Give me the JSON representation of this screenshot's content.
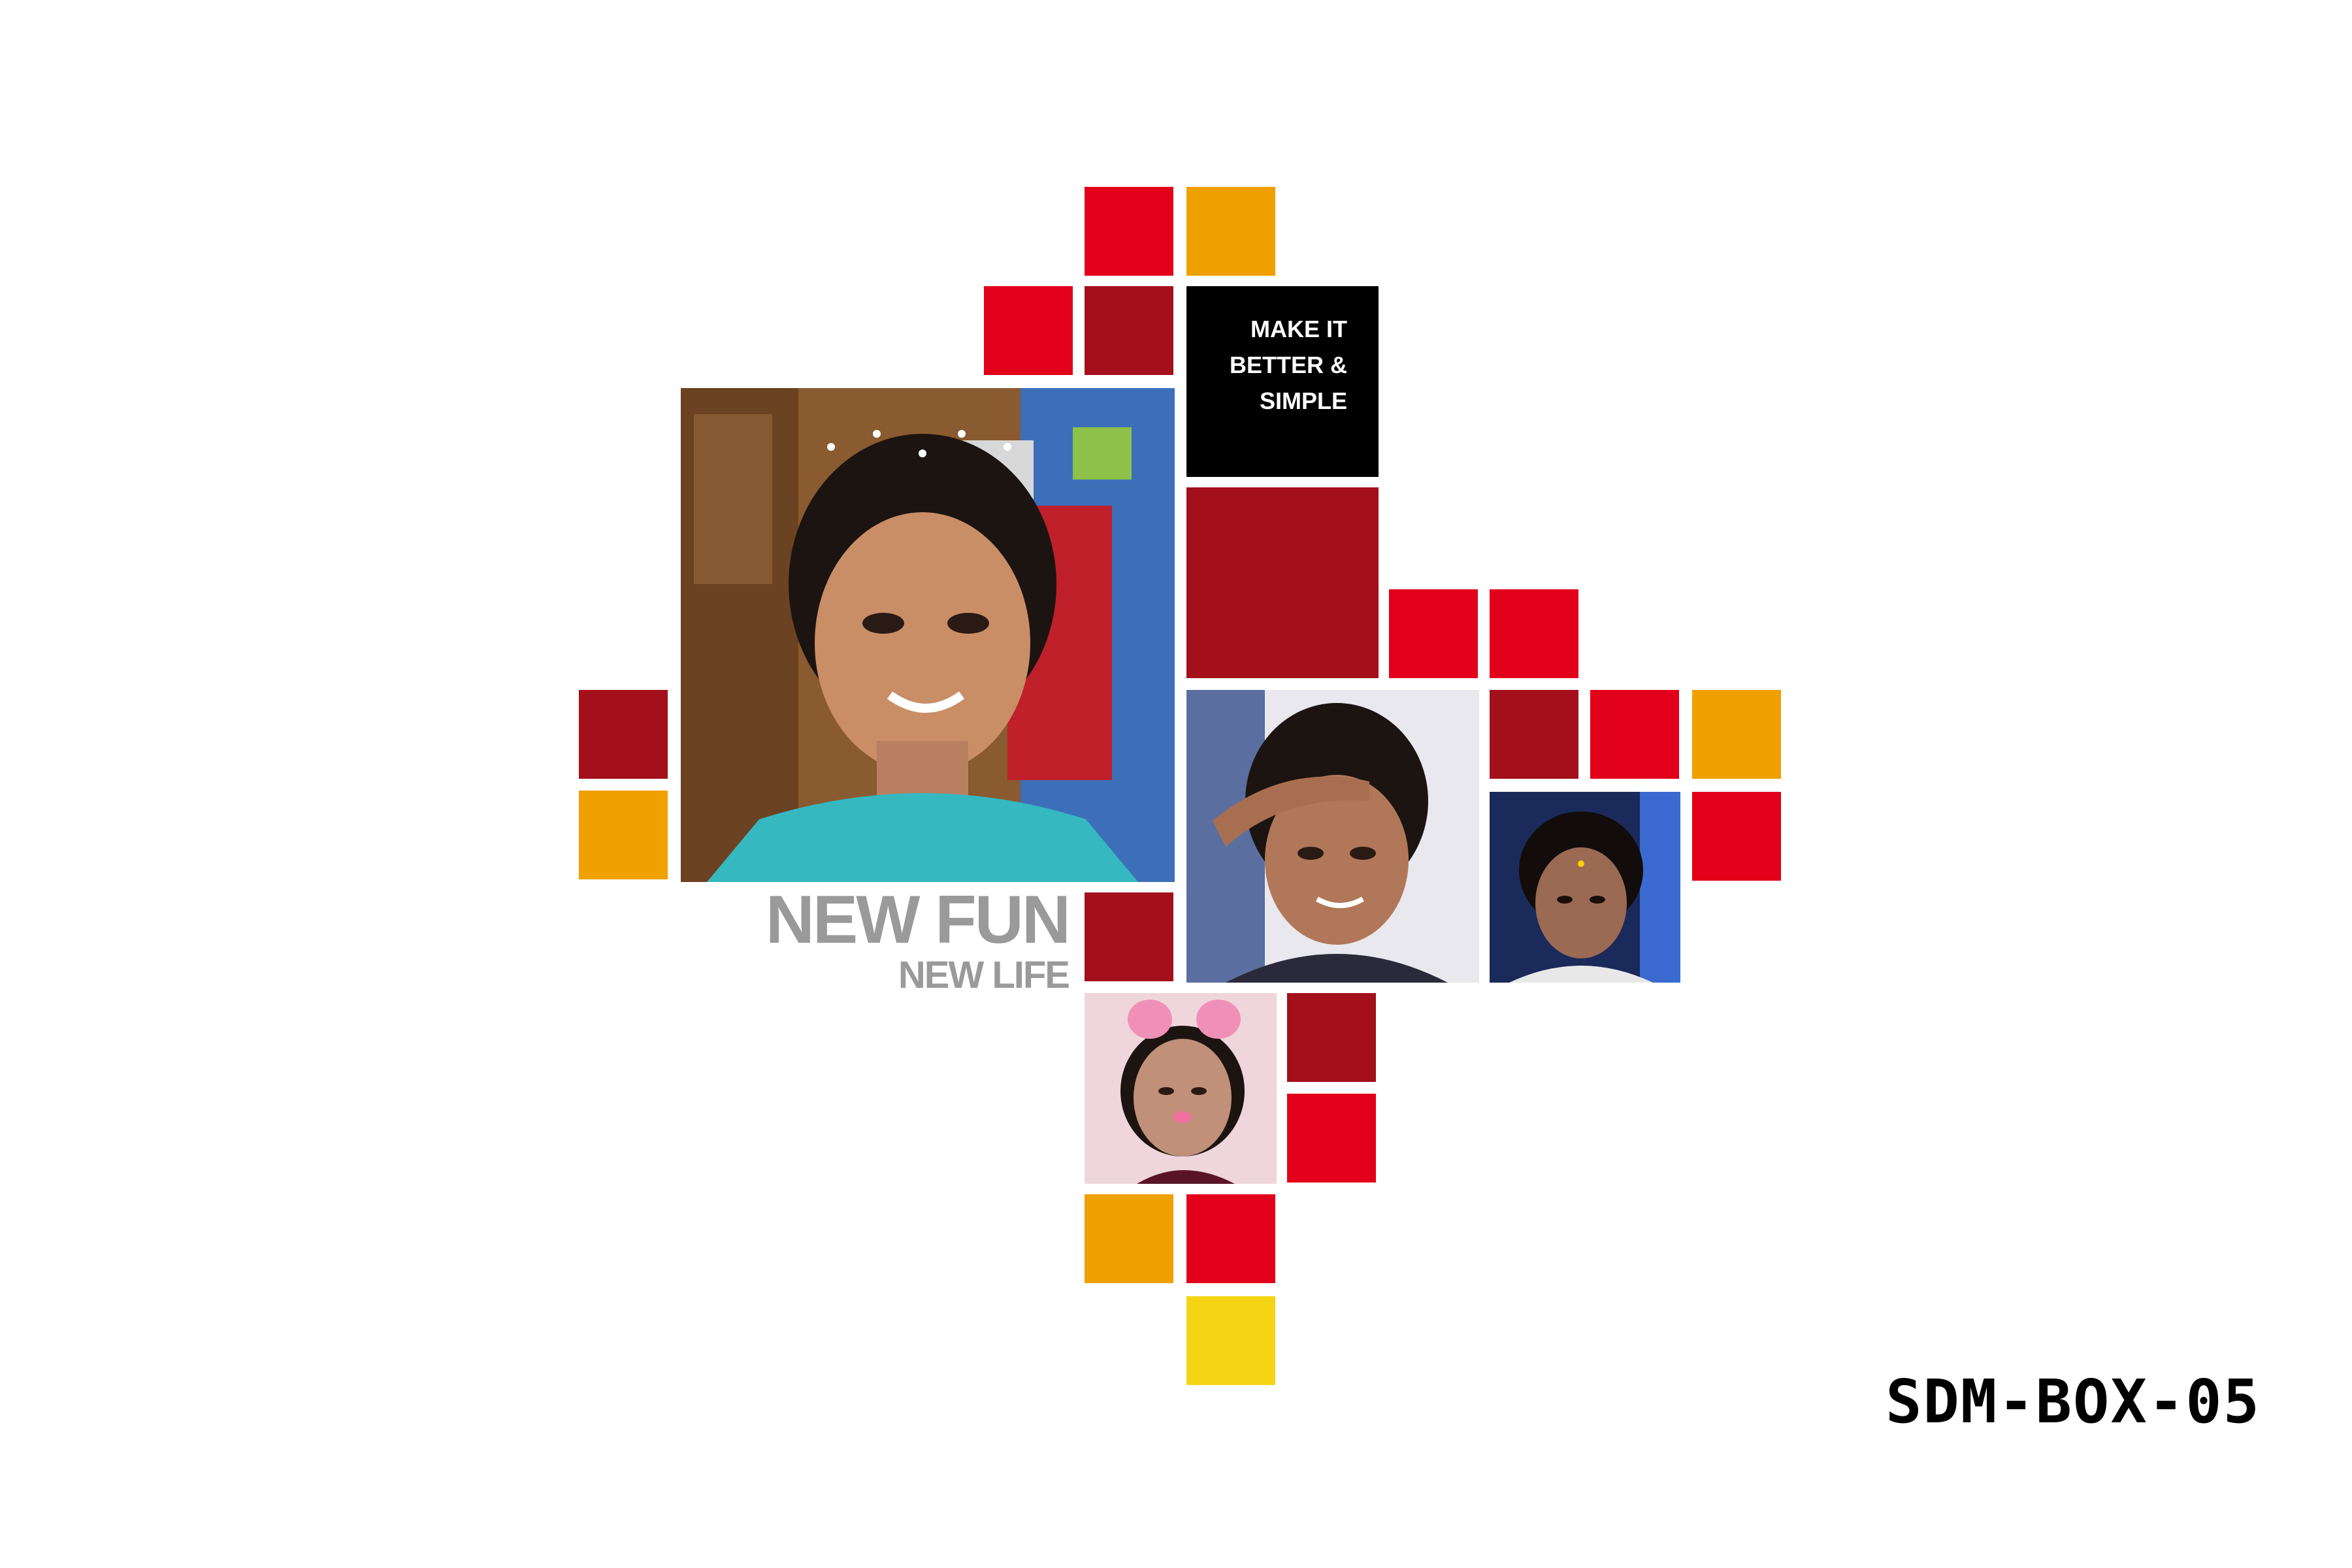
{
  "tagline": {
    "line1": "MAKE IT",
    "line2": "BETTER &",
    "line3": "SIMPLE"
  },
  "headline": {
    "line1": "NEW FUN",
    "line2": "NEW LIFE"
  },
  "code": "SDM-BOX-05",
  "colors": {
    "red": "#e2001a",
    "dark_red": "#a3101c",
    "orange": "#f0a000",
    "yellow": "#f5d414",
    "black": "#000000",
    "gray_text": "#9a9a9a"
  }
}
